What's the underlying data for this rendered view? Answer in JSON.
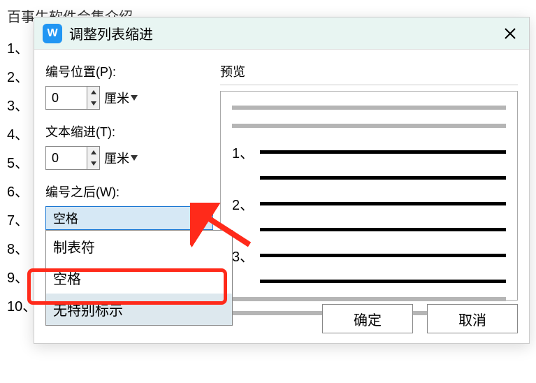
{
  "background": {
    "title": "百事生软件合集介绍",
    "list": [
      "1、",
      "2、",
      "3、",
      "4、",
      "5、",
      "6、",
      "7、",
      "8、",
      "9、",
      "10、"
    ]
  },
  "dialog": {
    "title": "调整列表缩进",
    "fields": {
      "number_pos_label": "编号位置(P):",
      "number_pos_value": "0",
      "number_pos_unit": "厘米",
      "text_indent_label": "文本缩进(T):",
      "text_indent_value": "0",
      "text_indent_unit": "厘米",
      "after_number_label": "编号之后(W):",
      "after_number_selected": "空格",
      "after_number_options": [
        "制表符",
        "空格",
        "无特别标示"
      ]
    },
    "preview_label": "预览",
    "preview_numbers": [
      "1、",
      "2、",
      "3、"
    ],
    "buttons": {
      "ok": "确定",
      "cancel": "取消"
    }
  }
}
